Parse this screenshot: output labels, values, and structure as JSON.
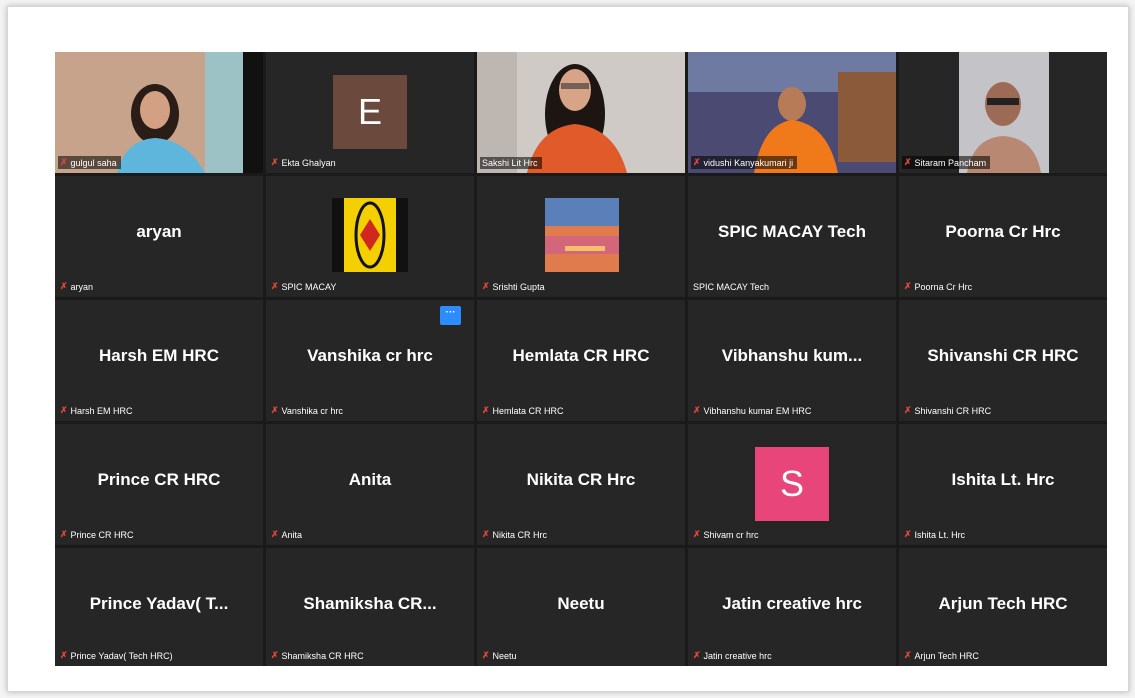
{
  "participants": [
    {
      "display": "",
      "label": "gulgul saha",
      "type": "video",
      "muted": true
    },
    {
      "display": "",
      "label": "Ekta Ghalyan",
      "type": "avatar",
      "initial": "E",
      "avatar_color": "#6b4a3d",
      "muted": true
    },
    {
      "display": "",
      "label": "Sakshi Lit Hrc",
      "type": "video",
      "muted": false,
      "active_speaker": true
    },
    {
      "display": "",
      "label": "vidushi Kanyakumari ji",
      "type": "video",
      "muted": true
    },
    {
      "display": "",
      "label": "Sitaram Pancham",
      "type": "video",
      "muted": true
    },
    {
      "display": "aryan",
      "label": "aryan",
      "type": "name",
      "muted": true
    },
    {
      "display": "",
      "label": "SPIC MACAY",
      "type": "logo",
      "muted": true
    },
    {
      "display": "",
      "label": "Srishti Gupta",
      "type": "picture",
      "muted": true
    },
    {
      "display": "SPIC MACAY Tech",
      "label": "SPIC MACAY Tech",
      "type": "name",
      "muted": false
    },
    {
      "display": "Poorna Cr Hrc",
      "label": "Poorna Cr Hrc",
      "type": "name",
      "muted": true
    },
    {
      "display": "Harsh EM HRC",
      "label": "Harsh EM HRC",
      "type": "name",
      "muted": true
    },
    {
      "display": "Vanshika cr hrc",
      "label": "Vanshika cr hrc",
      "type": "name",
      "muted": true
    },
    {
      "display": "Hemlata CR HRC",
      "label": "Hemlata CR HRC",
      "type": "name",
      "muted": true
    },
    {
      "display": "Vibhanshu  kum...",
      "label": "Vibhanshu kumar EM HRC",
      "type": "name",
      "muted": true
    },
    {
      "display": "Shivanshi CR HRC",
      "label": "Shivanshi CR HRC",
      "type": "name",
      "muted": true
    },
    {
      "display": "Prince CR HRC",
      "label": "Prince CR HRC",
      "type": "name",
      "muted": true
    },
    {
      "display": "Anita",
      "label": "Anita",
      "type": "name",
      "muted": true
    },
    {
      "display": "Nikita CR Hrc",
      "label": "Nikita CR Hrc",
      "type": "name",
      "muted": true
    },
    {
      "display": "",
      "label": "Shivam cr hrc",
      "type": "avatar",
      "initial": "S",
      "avatar_color": "#e8457a",
      "muted": true
    },
    {
      "display": "Ishita Lt. Hrc",
      "label": "Ishita Lt. Hrc",
      "type": "name",
      "muted": true
    },
    {
      "display": "Prince Yadav( T...",
      "label": "Prince Yadav( Tech HRC)",
      "type": "name",
      "muted": true
    },
    {
      "display": "Shamiksha  CR...",
      "label": "Shamiksha CR HRC",
      "type": "name",
      "muted": true
    },
    {
      "display": "Neetu",
      "label": "Neetu",
      "type": "name",
      "muted": true
    },
    {
      "display": "Jatin creative hrc",
      "label": "Jatin creative hrc",
      "type": "name",
      "muted": true
    },
    {
      "display": "Arjun Tech HRC",
      "label": "Arjun Tech HRC",
      "type": "name",
      "muted": true
    }
  ],
  "more_options_glyph": "···",
  "mic_muted_icon": "mic-muted-icon",
  "colors": {
    "active_speaker_border": "#a3d24a",
    "tile_bg": "#262626",
    "more_button": "#2d8cff"
  }
}
